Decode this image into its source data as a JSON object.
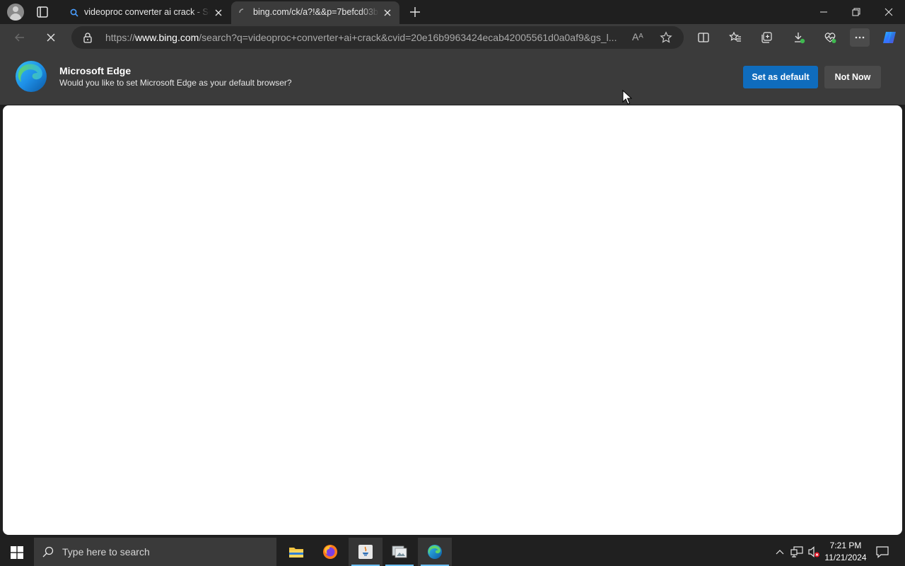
{
  "browser": {
    "tabs": [
      {
        "title": "videoproc converter ai crack - Search",
        "active": false,
        "favicon": "bing-search-icon"
      },
      {
        "title": "bing.com/ck/a?!&&p=7befcd03b…",
        "active": true,
        "favicon": "loading-spinner-icon"
      }
    ],
    "address": {
      "scheme": "https://",
      "host": "www.bing.com",
      "path": "/search?q=videoproc+converter+ai+crack&cvid=20e16b9963424ecab42005561d0a0af9&gs_l..."
    },
    "read_aloud_label": "Aᴬ"
  },
  "infobar": {
    "title": "Microsoft Edge",
    "message": "Would you like to set Microsoft Edge as your default browser?",
    "primary_button": "Set as default",
    "secondary_button": "Not Now"
  },
  "taskbar": {
    "search_placeholder": "Type here to search",
    "apps": [
      "file-explorer",
      "firefox",
      "java-app",
      "image-viewer",
      "microsoft-edge"
    ],
    "time": "7:21 PM",
    "date": "11/21/2024"
  },
  "colors": {
    "accent": "#0f6cbd",
    "toolbar": "#3b3b3b",
    "titlebar": "#1f1f1f",
    "taskbar": "#202020"
  }
}
